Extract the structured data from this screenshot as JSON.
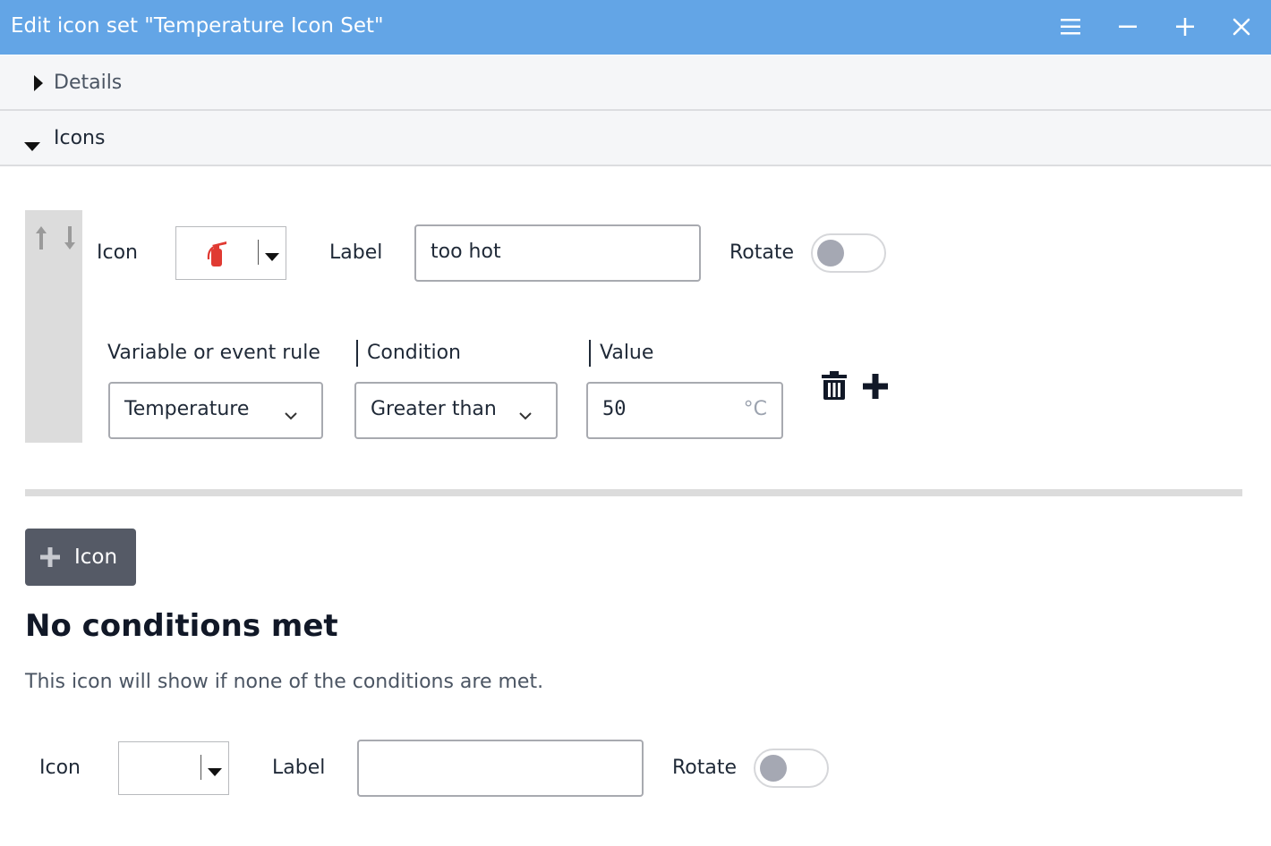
{
  "window": {
    "title": "Edit icon set \"Temperature Icon Set\"",
    "controls": [
      "menu-icon",
      "minimize-icon",
      "maximize-icon",
      "close-icon"
    ]
  },
  "accordion": {
    "details_label": "Details",
    "icons_label": "Icons"
  },
  "icon_entry": {
    "icon_label": "Icon",
    "selected_icon": "fire-extinguisher-icon",
    "label_label": "Label",
    "label_value": "too hot",
    "rotate_label": "Rotate",
    "rotate_on": false,
    "variable_header": "Variable or event rule",
    "condition_header": "Condition",
    "value_header": "Value",
    "variable_value": "Temperature",
    "condition_value": "Greater than",
    "value_value": "50",
    "value_unit": "°C"
  },
  "add_icon_button": {
    "label": "Icon"
  },
  "fallback": {
    "heading": "No conditions met",
    "description": "This icon will show if none of the conditions are met.",
    "icon_label": "Icon",
    "label_label": "Label",
    "label_value": "",
    "rotate_label": "Rotate",
    "rotate_on": false
  },
  "colors": {
    "titlebar": "#63a5e6",
    "icon_red": "#e03a32",
    "button_dark": "#555a66"
  }
}
